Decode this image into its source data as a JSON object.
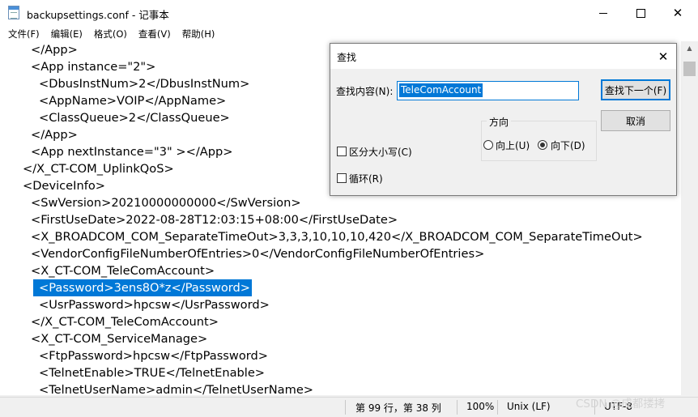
{
  "window": {
    "title": "backupsettings.conf - 记事本",
    "minimize_glyph": "",
    "close_glyph": "✕"
  },
  "menu": [
    "文件(F)",
    "编辑(E)",
    "格式(O)",
    "查看(V)",
    "帮助(H)"
  ],
  "editor": {
    "lines": [
      {
        "indent": 1,
        "text": "</App>"
      },
      {
        "indent": 1,
        "text": "<App instance=\"2\">"
      },
      {
        "indent": 2,
        "text": "<DbusInstNum>2</DbusInstNum>"
      },
      {
        "indent": 2,
        "text": "<AppName>VOIP</AppName>"
      },
      {
        "indent": 2,
        "text": "<ClassQueue>2</ClassQueue>"
      },
      {
        "indent": 1,
        "text": "</App>"
      },
      {
        "indent": 1,
        "text": "<App nextInstance=\"3\" ></App>"
      },
      {
        "indent": 0,
        "text": "</X_CT-COM_UplinkQoS>"
      },
      {
        "indent": 0,
        "text": "<DeviceInfo>"
      },
      {
        "indent": 1,
        "text": "<SwVersion>20210000000000</SwVersion>"
      },
      {
        "indent": 1,
        "text": "<FirstUseDate>2022-08-28T12:03:15+08:00</FirstUseDate>"
      },
      {
        "indent": 1,
        "text": "<X_BROADCOM_COM_SeparateTimeOut>3,3,3,10,10,10,420</X_BROADCOM_COM_SeparateTimeOut>"
      },
      {
        "indent": 1,
        "text": "<VendorConfigFileNumberOfEntries>0</VendorConfigFileNumberOfEntries>"
      },
      {
        "indent": 1,
        "text": "<X_CT-COM_TeleComAccount>"
      },
      {
        "indent": 2,
        "text": "<Password>3ens8O*z</Password>",
        "selected": true
      },
      {
        "indent": 2,
        "text": "<UsrPassword>hpcsw</UsrPassword>"
      },
      {
        "indent": 1,
        "text": "</X_CT-COM_TeleComAccount>"
      },
      {
        "indent": 1,
        "text": "<X_CT-COM_ServiceManage>"
      },
      {
        "indent": 2,
        "text": "<FtpPassword>hpcsw</FtpPassword>"
      },
      {
        "indent": 2,
        "text": "<TelnetEnable>TRUE</TelnetEnable>"
      },
      {
        "indent": 2,
        "text": "<TelnetUserName>admin</TelnetUserName>"
      }
    ]
  },
  "status": {
    "position": "第 99 行，第 38 列",
    "zoom": "100%",
    "line_ending": "Unix (LF)",
    "encoding": "UTF-8"
  },
  "watermark": "CSDN @成都搂拷",
  "find_dialog": {
    "title": "查找",
    "find_label": "查找内容(N):",
    "find_value": "TeleComAccount",
    "find_next": "查找下一个(F)",
    "cancel": "取消",
    "direction_label": "方向",
    "up_label": "向上(U)",
    "down_label": "向下(D)",
    "direction_selected": "down",
    "match_case_label": "区分大小写(C)",
    "match_case_checked": false,
    "wrap_label": "循环(R)",
    "wrap_checked": false
  },
  "colors": {
    "selection": "#0078d7",
    "dialog_bg": "#f0f0f0"
  }
}
